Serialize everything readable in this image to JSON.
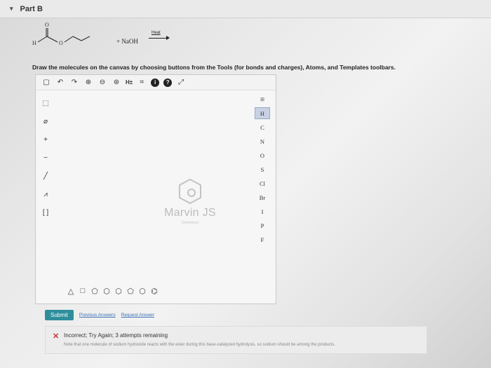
{
  "part": {
    "caret": "▾",
    "title": "Part B"
  },
  "reaction": {
    "reagent": "+ NaOH",
    "condition": "Heat",
    "atom_o_top": "O",
    "atom_h": "H",
    "atom_o_ring": "O"
  },
  "instructions": "Draw the molecules on the canvas by choosing buttons from the Tools (for bonds and charges), Atoms, and Templates toolbars.",
  "editor": {
    "top_toolbar": {
      "h_label": "H±",
      "info": "i",
      "help": "?"
    },
    "right_toolbar": {
      "periodic": "⊞",
      "atoms": [
        "H",
        "C",
        "N",
        "O",
        "S",
        "Cl",
        "Br",
        "I",
        "P",
        "F"
      ],
      "selected": "H"
    },
    "logo": {
      "brand": "Marvin JS",
      "sub": "ChemAxon"
    },
    "bottom_toolbar": [
      "△",
      "□",
      "⬠",
      "⬡",
      "⬡",
      "⬠",
      "⬡",
      "⌬"
    ]
  },
  "actions": {
    "submit": "Submit",
    "previous": "Previous Answers",
    "request": "Request Answer"
  },
  "feedback": {
    "title": "Incorrect; Try Again; 3 attempts remaining",
    "note": "Note that one molecule of sodium hydroxide reacts with the ester during this base-catalyzed hydrolysis, so sodium should be among the products.",
    "status_color": "#cc3333"
  }
}
